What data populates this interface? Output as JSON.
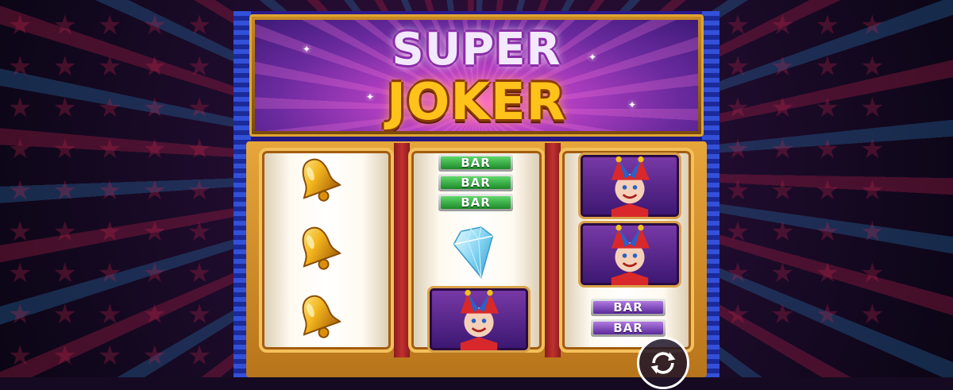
{
  "game": {
    "title_line1": "SUPER",
    "title_line2": "JOKER"
  },
  "reels": [
    {
      "symbols": [
        "bell-icon",
        "bell-icon",
        "bell-icon"
      ]
    },
    {
      "symbols": [
        "bar-green",
        "bar-green",
        "bar-green",
        "diamond-icon",
        "joker-icon"
      ]
    },
    {
      "symbols": [
        "joker-icon",
        "joker-icon",
        "bar-purple",
        "bar-purple"
      ]
    }
  ],
  "bar_label": "BAR",
  "colors": {
    "frame_gold": "#e6a63a",
    "bar_green": "#1d8a2a",
    "bar_purple": "#5a2a9a",
    "logo_gold": "#ffc21a"
  }
}
